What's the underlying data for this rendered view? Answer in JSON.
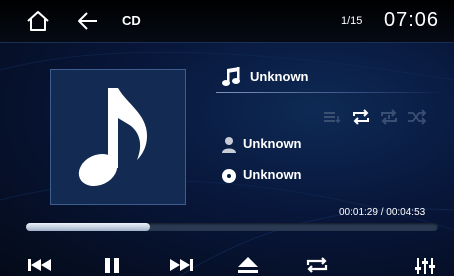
{
  "header": {
    "home_icon": "home-icon",
    "back_icon": "back-arrow-icon",
    "source": "CD",
    "track_counter": "1/15",
    "clock": "07:06"
  },
  "album_art": {
    "icon": "music-note-icon"
  },
  "track": {
    "title_icon": "music-note-icon",
    "title": "Unknown",
    "artist_icon": "person-icon",
    "artist": "Unknown",
    "album_icon": "disc-icon",
    "album": "Unknown"
  },
  "play_modes": [
    "playlist-icon",
    "repeat-all-icon",
    "repeat-one-icon",
    "shuffle-icon"
  ],
  "playback": {
    "elapsed": "00:01:29",
    "separator": "/",
    "total": "00:04:53",
    "progress_fraction": 0.3
  },
  "controls": [
    "previous-icon",
    "pause-icon",
    "next-icon",
    "eject-icon",
    "repeat-icon",
    "equalizer-icon"
  ],
  "colors": {
    "background": "#050b18",
    "panel": "#132a52",
    "text": "#ffffff",
    "inactive_icon": "#3b4f72"
  }
}
